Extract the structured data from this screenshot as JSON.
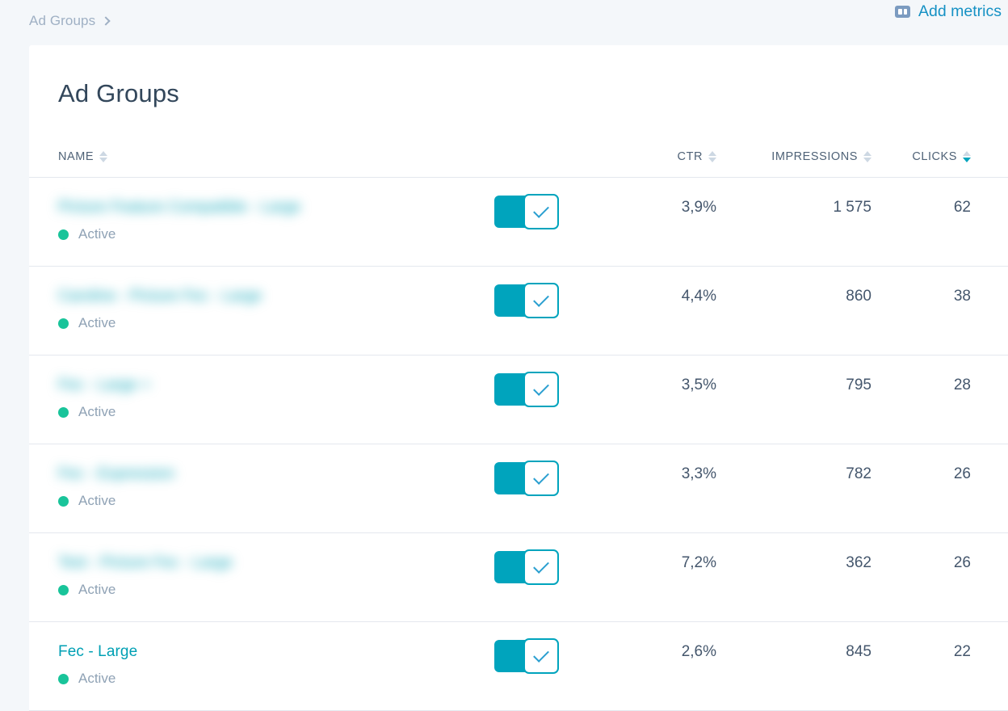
{
  "topbar": {
    "breadcrumb": {
      "label": "Ad Groups",
      "chevron_icon": "chevron-right-icon"
    },
    "add_metrics": {
      "label": "Add metrics",
      "icon": "columns-icon"
    }
  },
  "card": {
    "title": "Ad Groups"
  },
  "table": {
    "columns": [
      {
        "key": "name",
        "label": "NAME",
        "sort": "none",
        "align": "left"
      },
      {
        "key": "toggle",
        "label": "",
        "sort": "none",
        "align": "left"
      },
      {
        "key": "ctr",
        "label": "CTR",
        "sort": "none",
        "align": "right"
      },
      {
        "key": "impressions",
        "label": "IMPRESSIONS",
        "sort": "none",
        "align": "right"
      },
      {
        "key": "clicks",
        "label": "CLICKS",
        "sort": "desc",
        "align": "right"
      }
    ],
    "rows": [
      {
        "name": "Picture Feature Compatible - Large",
        "redacted": true,
        "status": "Active",
        "enabled": true,
        "ctr": "3,9%",
        "impressions": "1 575",
        "clicks": "62"
      },
      {
        "name": "Caroline - Picture Fec - Large",
        "redacted": true,
        "status": "Active",
        "enabled": true,
        "ctr": "4,4%",
        "impressions": "860",
        "clicks": "38"
      },
      {
        "name": "Fec - Large +",
        "redacted": true,
        "status": "Active",
        "enabled": true,
        "ctr": "3,5%",
        "impressions": "795",
        "clicks": "28"
      },
      {
        "name": "Fec - Expression",
        "redacted": true,
        "status": "Active",
        "enabled": true,
        "ctr": "3,3%",
        "impressions": "782",
        "clicks": "26"
      },
      {
        "name": "Test - Picture Fec - Large",
        "redacted": true,
        "status": "Active",
        "enabled": true,
        "ctr": "7,2%",
        "impressions": "362",
        "clicks": "26"
      },
      {
        "name": "Fec - Large",
        "redacted": false,
        "status": "Active",
        "enabled": true,
        "ctr": "2,6%",
        "impressions": "845",
        "clicks": "22"
      }
    ]
  },
  "colors": {
    "page_background": "#f4f7fa",
    "card_background": "#ffffff",
    "accent_teal": "#00a4bd",
    "link_teal": "#00a0b4",
    "link_blue": "#1591c4",
    "status_green": "#19c49a",
    "text_dark": "#33475b",
    "text_muted": "#8fa2b5",
    "divider": "#e4e8ee"
  }
}
